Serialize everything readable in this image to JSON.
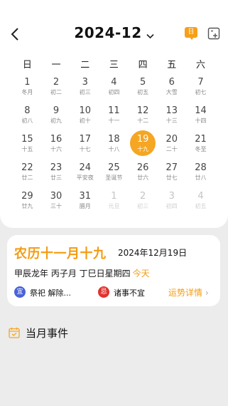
{
  "header": {
    "title": "2024-12",
    "today_label": "日"
  },
  "weekdays": [
    "日",
    "一",
    "二",
    "三",
    "四",
    "五",
    "六"
  ],
  "calendar": {
    "rows": [
      [
        {
          "d": "1",
          "l": "冬月"
        },
        {
          "d": "2",
          "l": "初二"
        },
        {
          "d": "3",
          "l": "初三"
        },
        {
          "d": "4",
          "l": "初四"
        },
        {
          "d": "5",
          "l": "初五"
        },
        {
          "d": "6",
          "l": "大雪"
        },
        {
          "d": "7",
          "l": "初七"
        }
      ],
      [
        {
          "d": "8",
          "l": "初八"
        },
        {
          "d": "9",
          "l": "初九"
        },
        {
          "d": "10",
          "l": "初十"
        },
        {
          "d": "11",
          "l": "十一"
        },
        {
          "d": "12",
          "l": "十二"
        },
        {
          "d": "13",
          "l": "十三"
        },
        {
          "d": "14",
          "l": "十四"
        }
      ],
      [
        {
          "d": "15",
          "l": "十五"
        },
        {
          "d": "16",
          "l": "十六"
        },
        {
          "d": "17",
          "l": "十七"
        },
        {
          "d": "18",
          "l": "十八"
        },
        {
          "d": "19",
          "l": "十九"
        },
        {
          "d": "20",
          "l": "二十"
        },
        {
          "d": "21",
          "l": "冬至"
        }
      ],
      [
        {
          "d": "22",
          "l": "廿二"
        },
        {
          "d": "23",
          "l": "廿三"
        },
        {
          "d": "24",
          "l": "平安夜"
        },
        {
          "d": "25",
          "l": "圣诞节"
        },
        {
          "d": "26",
          "l": "廿六"
        },
        {
          "d": "27",
          "l": "廿七"
        },
        {
          "d": "28",
          "l": "廿八"
        }
      ],
      [
        {
          "d": "29",
          "l": "廿九"
        },
        {
          "d": "30",
          "l": "三十"
        },
        {
          "d": "31",
          "l": "腊月"
        },
        {
          "d": "1",
          "l": "元旦"
        },
        {
          "d": "2",
          "l": "初三"
        },
        {
          "d": "3",
          "l": "初四"
        },
        {
          "d": "4",
          "l": "初五"
        }
      ]
    ]
  },
  "info": {
    "lunar_title": "农历十一月十九",
    "solar_date": "2024年12月19日",
    "ganzhi": "甲辰龙年 丙子月 丁巳日星期四",
    "today": "今天",
    "yi_badge": "宜",
    "yi_text": "祭祀 解除...",
    "ji_badge": "忌",
    "ji_text": "诸事不宜",
    "fortune": "运势详情",
    "fortune_arrow": "›"
  },
  "events": {
    "label": "当月事件"
  },
  "colors": {
    "accent": "#f5a623",
    "yi": "#4a63d8",
    "ji": "#e0322f"
  }
}
